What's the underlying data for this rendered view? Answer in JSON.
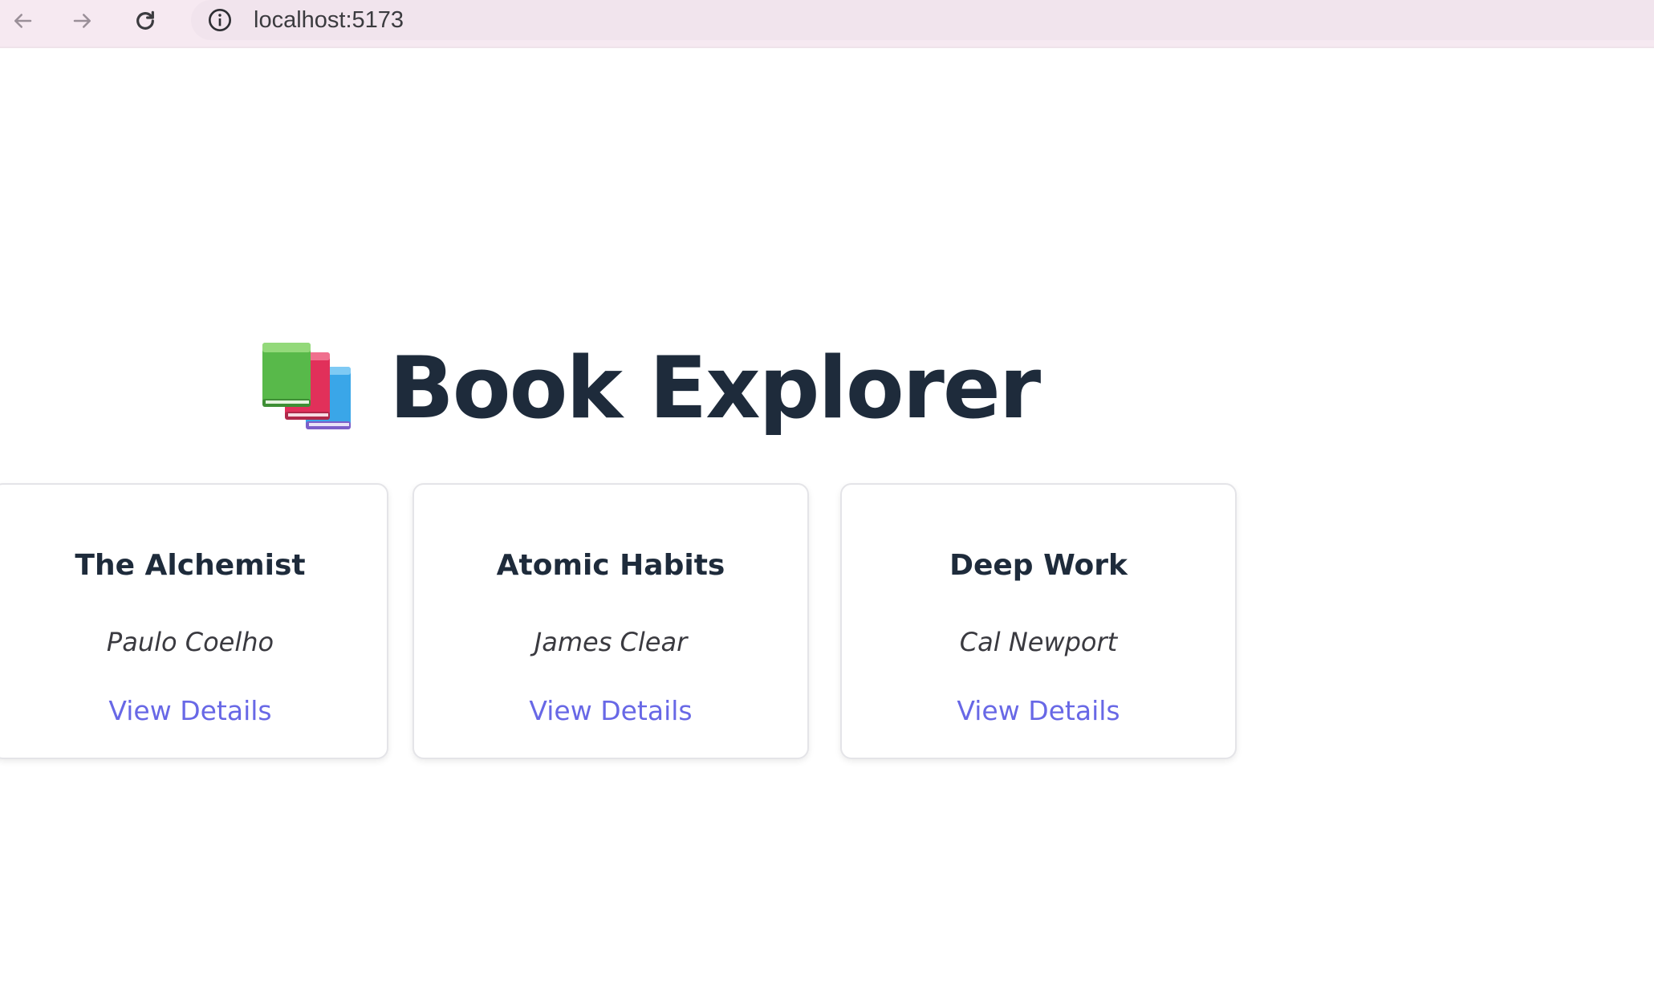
{
  "browser": {
    "url": "localhost:5173",
    "icons": [
      "back-arrow-icon",
      "forward-arrow-icon",
      "reload-icon",
      "info-icon"
    ]
  },
  "header": {
    "icon": "books-icon",
    "title": "Book Explorer"
  },
  "books": [
    {
      "title": "The Alchemist",
      "author": "Paulo Coelho",
      "link": "View Details"
    },
    {
      "title": "Atomic Habits",
      "author": "James Clear",
      "link": "View Details"
    },
    {
      "title": "Deep Work",
      "author": "Cal Newport",
      "link": "View Details"
    }
  ],
  "colors": {
    "title": "#1e2b3b",
    "link": "#6868e6",
    "browser_bar": "#f6e9f1"
  }
}
